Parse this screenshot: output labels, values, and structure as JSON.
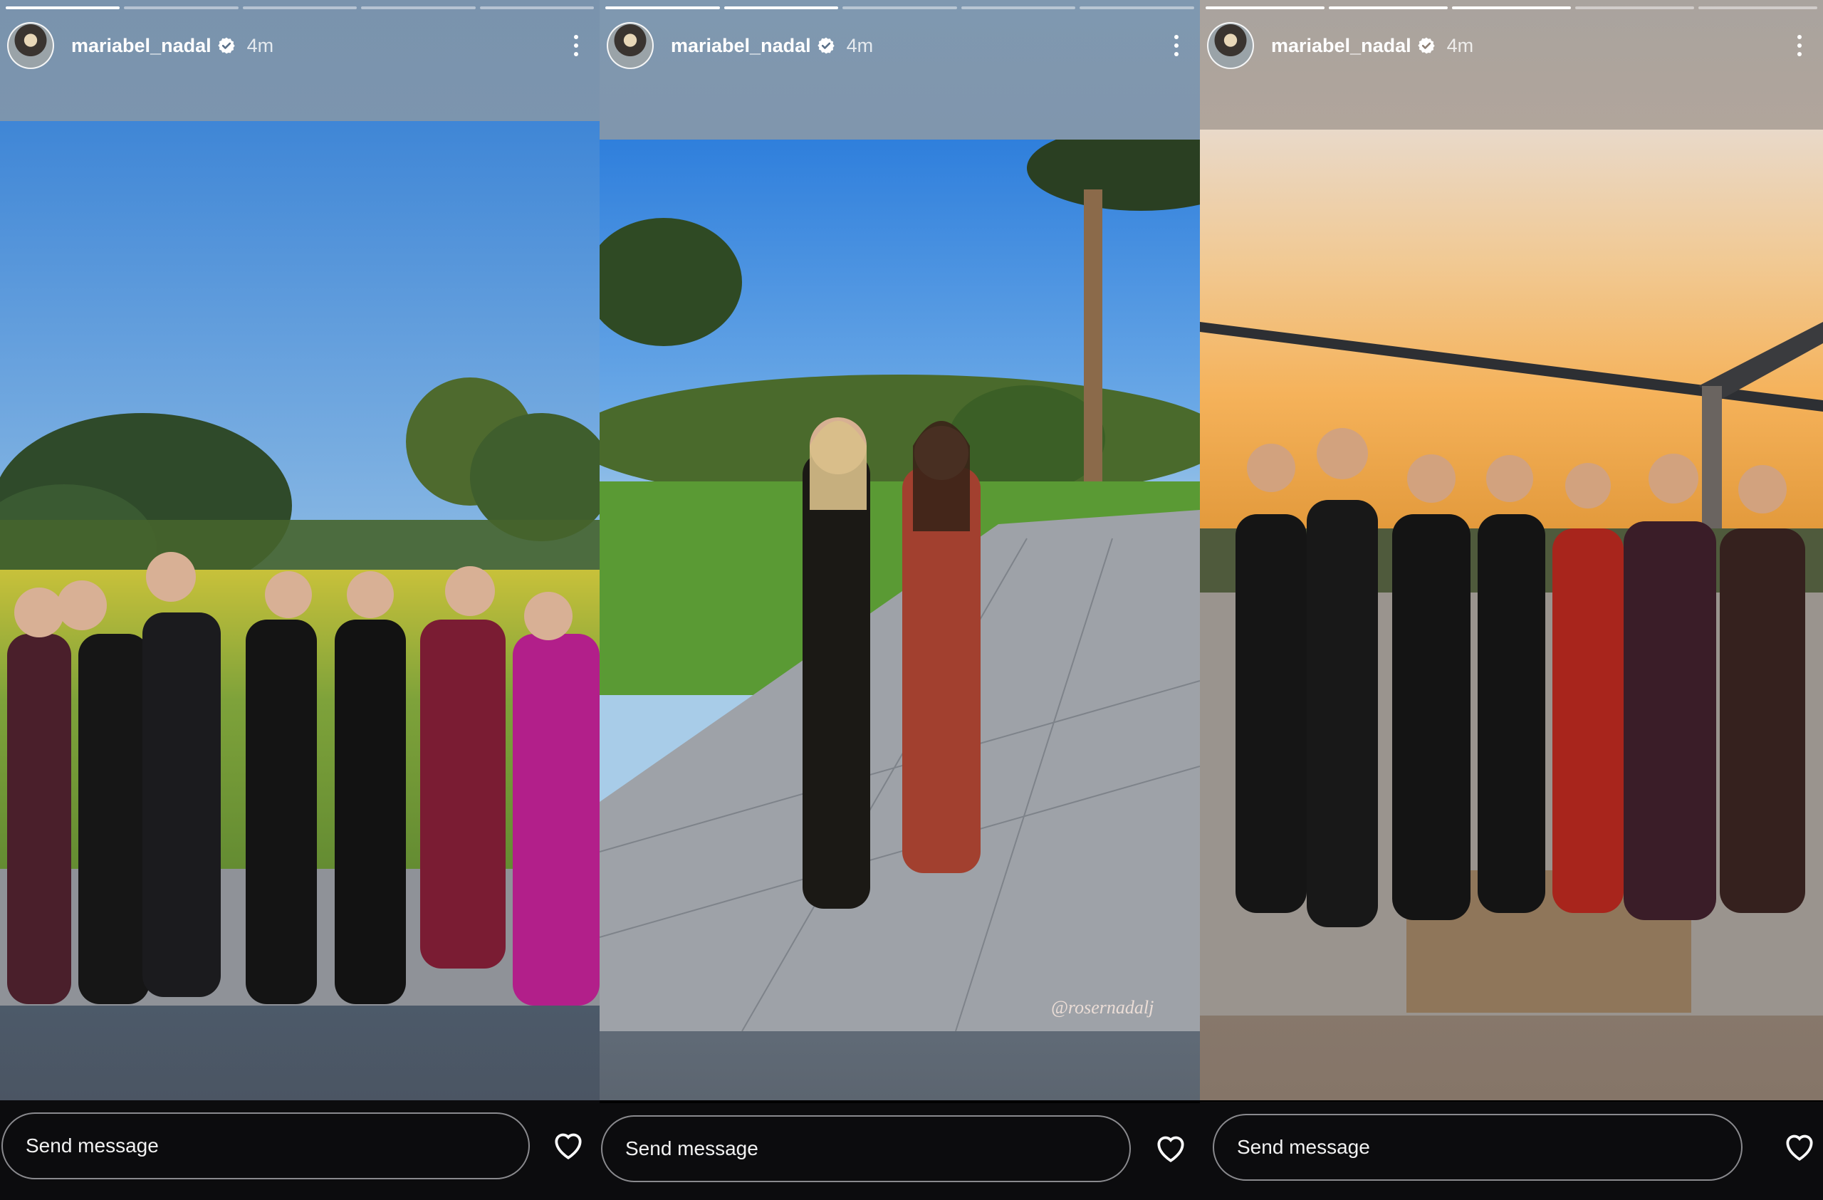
{
  "stories": [
    {
      "user": {
        "username": "mariabel_nadal",
        "time": "4m",
        "verified": true
      },
      "progress": {
        "segments": 5,
        "active": 0
      },
      "photo_alt": "Seven women in formal dresses posing on a golf course terrace",
      "footer": {
        "message_placeholder": "Send message"
      }
    },
    {
      "user": {
        "username": "mariabel_nadal",
        "time": "4m",
        "verified": true
      },
      "progress": {
        "segments": 5,
        "active": 1
      },
      "photo_alt": "Two women walking on a stone path at a golf course",
      "mention": "@rosernadalj",
      "footer": {
        "message_placeholder": "Send message"
      }
    },
    {
      "user": {
        "username": "mariabel_nadal",
        "time": "4m",
        "verified": true
      },
      "progress": {
        "segments": 5,
        "active": 2
      },
      "photo_alt": "Seven women in evening dresses at sunset under a pergola",
      "footer": {
        "message_placeholder": "Send message"
      }
    }
  ],
  "colors": {
    "footer_bg": "#0c0c0e",
    "text": "#ffffff",
    "verified_blue": "#ffffff"
  },
  "icons": {
    "verified": "verified-badge-icon",
    "more": "more-vertical-icon",
    "heart": "heart-outline-icon"
  }
}
